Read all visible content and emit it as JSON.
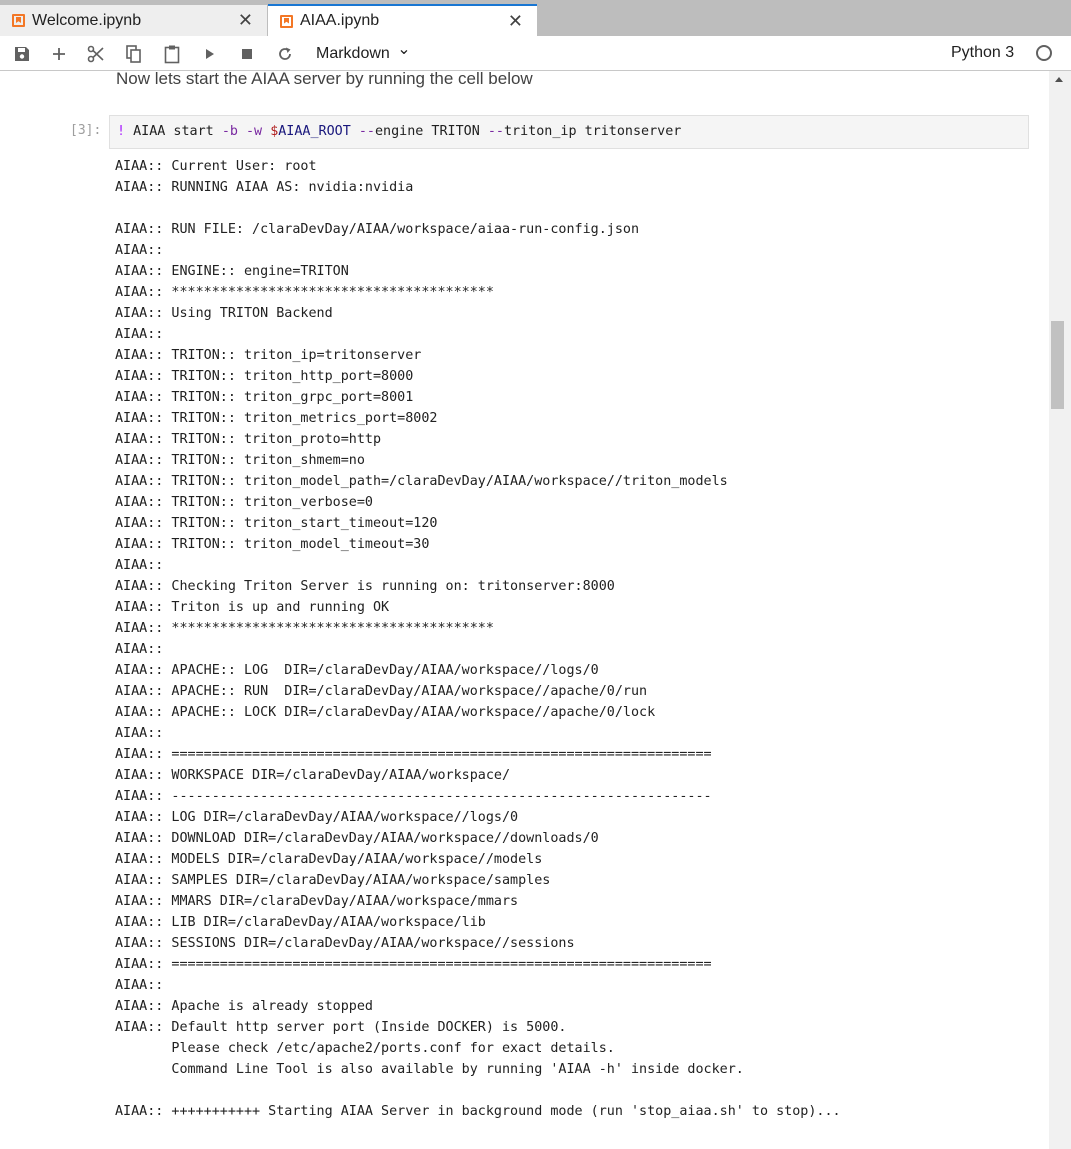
{
  "tabs": [
    {
      "label": "Welcome.ipynb",
      "close": "✕",
      "active": false
    },
    {
      "label": "AIAA.ipynb",
      "close": "✕",
      "active": true
    }
  ],
  "toolbar": {
    "icons": [
      "save-icon",
      "add-icon",
      "cut-icon",
      "copy-icon",
      "paste-icon",
      "run-icon",
      "stop-icon",
      "restart-icon"
    ],
    "cell_type": "Markdown",
    "cell_type_arrow": "⌄",
    "kernel_name": "Python 3"
  },
  "notebook": {
    "markdown_text": "Now lets start the AIAA server by running the cell below",
    "cell": {
      "prompt": "[3]:",
      "code": {
        "bang": "!",
        "cmd": " AIAA start ",
        "opt1": "-b",
        "sp1": " ",
        "opt2": "-w",
        "sp2": " ",
        "dollar": "$",
        "var": "AIAA_ROOT",
        "sp3": " ",
        "opt3": "--",
        "engine": "engine TRITON ",
        "opt4": "--",
        "tip": "triton_ip tritonserver"
      },
      "output_lines": [
        "AIAA:: Current User: root",
        "AIAA:: RUNNING AIAA AS: nvidia:nvidia",
        "",
        "AIAA:: RUN FILE: /claraDevDay/AIAA/workspace/aiaa-run-config.json",
        "AIAA::",
        "AIAA:: ENGINE:: engine=TRITON",
        "AIAA:: ****************************************",
        "AIAA:: Using TRITON Backend",
        "AIAA::",
        "AIAA:: TRITON:: triton_ip=tritonserver",
        "AIAA:: TRITON:: triton_http_port=8000",
        "AIAA:: TRITON:: triton_grpc_port=8001",
        "AIAA:: TRITON:: triton_metrics_port=8002",
        "AIAA:: TRITON:: triton_proto=http",
        "AIAA:: TRITON:: triton_shmem=no",
        "AIAA:: TRITON:: triton_model_path=/claraDevDay/AIAA/workspace//triton_models",
        "AIAA:: TRITON:: triton_verbose=0",
        "AIAA:: TRITON:: triton_start_timeout=120",
        "AIAA:: TRITON:: triton_model_timeout=30",
        "AIAA::",
        "AIAA:: Checking Triton Server is running on: tritonserver:8000",
        "AIAA:: Triton is up and running OK",
        "AIAA:: ****************************************",
        "AIAA::",
        "AIAA:: APACHE:: LOG  DIR=/claraDevDay/AIAA/workspace//logs/0",
        "AIAA:: APACHE:: RUN  DIR=/claraDevDay/AIAA/workspace//apache/0/run",
        "AIAA:: APACHE:: LOCK DIR=/claraDevDay/AIAA/workspace//apache/0/lock",
        "AIAA::",
        "AIAA:: ===================================================================",
        "AIAA:: WORKSPACE DIR=/claraDevDay/AIAA/workspace/",
        "AIAA:: -------------------------------------------------------------------",
        "AIAA:: LOG DIR=/claraDevDay/AIAA/workspace//logs/0",
        "AIAA:: DOWNLOAD DIR=/claraDevDay/AIAA/workspace//downloads/0",
        "AIAA:: MODELS DIR=/claraDevDay/AIAA/workspace//models",
        "AIAA:: SAMPLES DIR=/claraDevDay/AIAA/workspace/samples",
        "AIAA:: MMARS DIR=/claraDevDay/AIAA/workspace/mmars",
        "AIAA:: LIB DIR=/claraDevDay/AIAA/workspace/lib",
        "AIAA:: SESSIONS DIR=/claraDevDay/AIAA/workspace//sessions",
        "AIAA:: ===================================================================",
        "AIAA::",
        "AIAA:: Apache is already stopped",
        "AIAA:: Default http server port (Inside DOCKER) is 5000.",
        "       Please check /etc/apache2/ports.conf for exact details.",
        "       Command Line Tool is also available by running 'AIAA -h' inside docker.",
        "",
        "AIAA:: +++++++++++ Starting AIAA Server in background mode (run 'stop_aiaa.sh' to stop)..."
      ]
    }
  }
}
